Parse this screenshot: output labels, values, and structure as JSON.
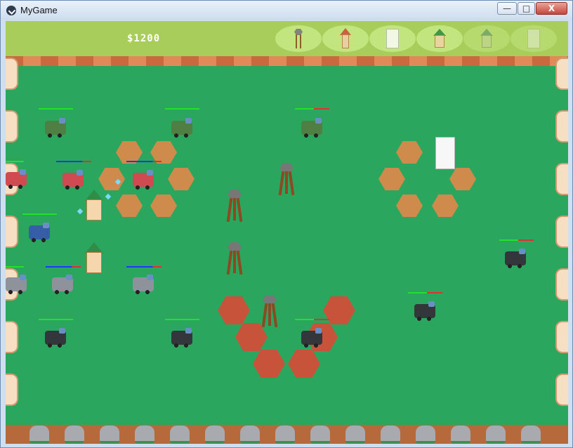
{
  "window": {
    "title": "MyGame",
    "minimize_label": "—",
    "maximize_label": "□",
    "close_label": "X"
  },
  "hud": {
    "money": "$1200",
    "build_options": [
      {
        "name": "watchtower-icon",
        "state": "available"
      },
      {
        "name": "red-roof-tower-icon",
        "state": "available"
      },
      {
        "name": "white-block-icon",
        "state": "available"
      },
      {
        "name": "green-roof-house-icon",
        "state": "available"
      },
      {
        "name": "faded-sprout-icon",
        "state": "disabled"
      },
      {
        "name": "faded-block-icon",
        "state": "disabled"
      }
    ]
  },
  "colors": {
    "grass": "#2aa65e",
    "hud": "#a9cd5b",
    "enemy_health": "#25e02a",
    "damage": "#e03030",
    "player_health": "#1f38ff"
  }
}
